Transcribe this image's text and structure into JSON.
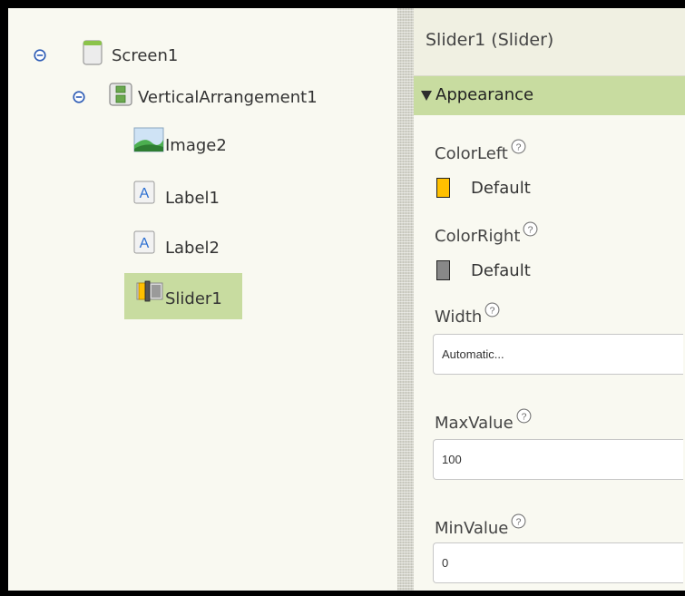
{
  "tree": {
    "screen": {
      "label": "Screen1",
      "icon": "screen-icon",
      "toggle": "collapse-icon"
    },
    "arrangement": {
      "label": "VerticalArrangement1",
      "icon": "vertical-arrangement-icon",
      "toggle": "collapse-icon"
    },
    "children": [
      {
        "label": "Image2",
        "icon": "image-icon"
      },
      {
        "label": "Label1",
        "icon": "label-icon"
      },
      {
        "label": "Label2",
        "icon": "label-icon"
      },
      {
        "label": "Slider1",
        "icon": "slider-icon",
        "selected": true
      }
    ]
  },
  "properties": {
    "title": "Slider1 (Slider)",
    "section": "Appearance",
    "color_left": {
      "label": "ColorLeft",
      "value": "Default",
      "swatch": "#ffc000"
    },
    "color_right": {
      "label": "ColorRight",
      "value": "Default",
      "swatch": "#888888"
    },
    "width": {
      "label": "Width",
      "value": "Automatic..."
    },
    "max_value": {
      "label": "MaxValue",
      "value": "100"
    },
    "min_value": {
      "label": "MinValue",
      "value": "0"
    },
    "help_icon": "help-icon"
  },
  "colors": {
    "panel_bg": "#f9f9f1",
    "header_bg": "#f0f0e2",
    "selection_bg": "#c8dca0",
    "toggle_blue": "#2c5bb5"
  }
}
